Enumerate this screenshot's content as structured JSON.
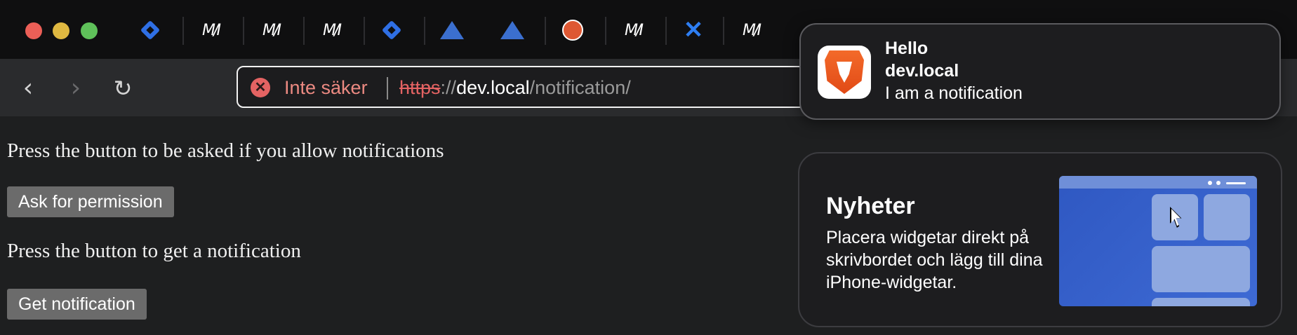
{
  "browser": {
    "tabs": [
      {
        "icon": "jira-diamond-icon"
      },
      {
        "icon": "mm-icon"
      },
      {
        "icon": "mm-icon"
      },
      {
        "icon": "mm-icon"
      },
      {
        "icon": "jira-diamond-icon"
      },
      {
        "icon": "triangle-icon"
      },
      {
        "icon": "triangle-icon"
      },
      {
        "icon": "duckduckgo-icon"
      },
      {
        "icon": "mm-icon"
      },
      {
        "icon": "confluence-icon"
      },
      {
        "icon": "mm-icon"
      }
    ],
    "mm_glyph": "M/I",
    "address": {
      "security_label": "Inte säker",
      "scheme": "https",
      "separator": "://",
      "host": "dev.local",
      "path": "/notification/"
    }
  },
  "page": {
    "permission_text": "Press the button to be asked if you allow notifications",
    "permission_button": "Ask for permission",
    "notify_text": "Press the button to get a notification",
    "notify_button": "Get notification"
  },
  "notification": {
    "title": "Hello",
    "subtitle": "dev.local",
    "body": "I am a notification",
    "app_icon": "brave-icon"
  },
  "widget": {
    "title": "Nyheter",
    "body": "Placera widgetar direkt på skrivbordet och lägg till dina iPhone-widgetar."
  },
  "colors": {
    "page_bg": "#1e1f20",
    "insecure_red": "#e46363",
    "brave_orange": "#f36a2a"
  }
}
